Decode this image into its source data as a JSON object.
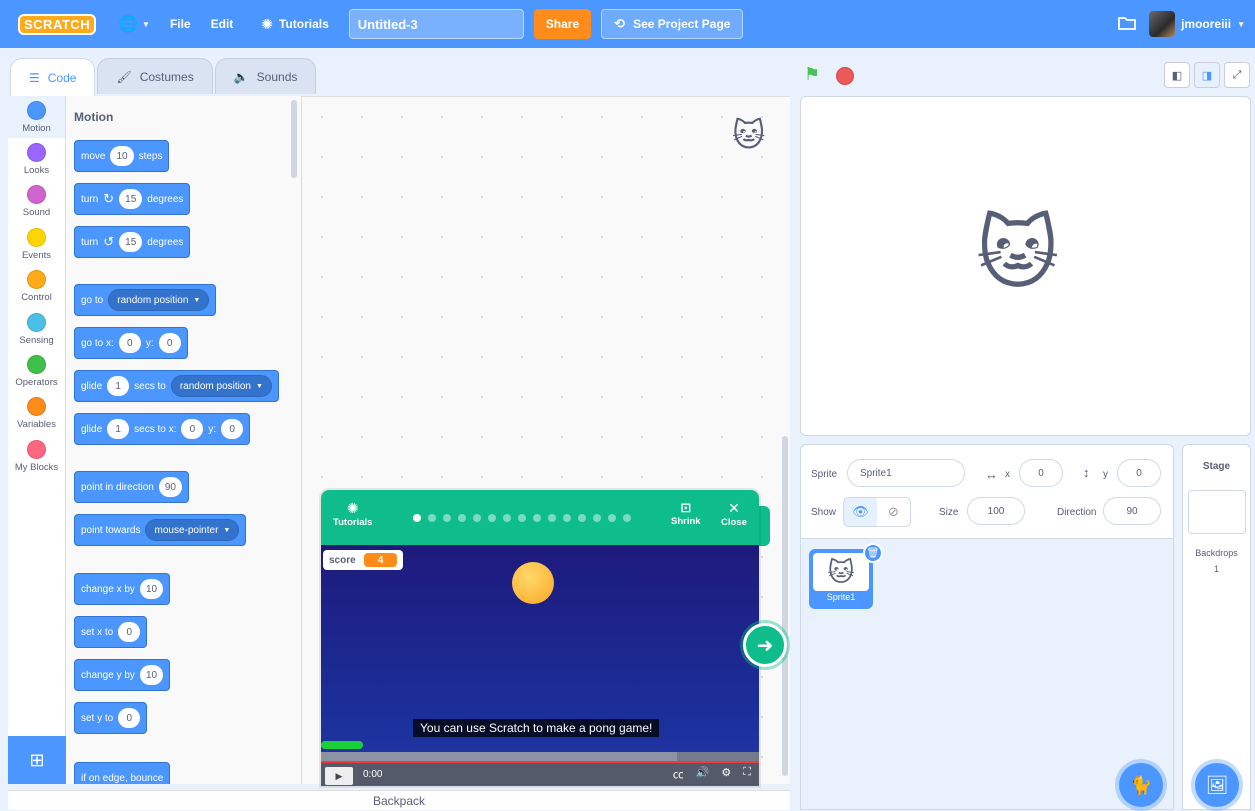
{
  "menubar": {
    "logo": "SCRATCH",
    "file": "File",
    "edit": "Edit",
    "tutorials": "Tutorials",
    "project_title": "Untitled-3",
    "share": "Share",
    "see_project": "See Project Page",
    "username": "jmooreiii"
  },
  "tabs": {
    "code": "Code",
    "costumes": "Costumes",
    "sounds": "Sounds"
  },
  "categories": [
    {
      "label": "Motion",
      "color": "#4c97ff"
    },
    {
      "label": "Looks",
      "color": "#9966ff"
    },
    {
      "label": "Sound",
      "color": "#cf63cf"
    },
    {
      "label": "Events",
      "color": "#ffd500"
    },
    {
      "label": "Control",
      "color": "#ffab19"
    },
    {
      "label": "Sensing",
      "color": "#4cbfe6"
    },
    {
      "label": "Operators",
      "color": "#40bf4a"
    },
    {
      "label": "Variables",
      "color": "#ff8c1a"
    },
    {
      "label": "My Blocks",
      "color": "#ff6680"
    }
  ],
  "palette": {
    "title": "Motion",
    "move": {
      "pre": "move",
      "val": "10",
      "post": "steps"
    },
    "turn_right": {
      "pre": "turn",
      "icon": "↻",
      "val": "15",
      "post": "degrees"
    },
    "turn_left": {
      "pre": "turn",
      "icon": "↺",
      "val": "15",
      "post": "degrees"
    },
    "goto": {
      "pre": "go to",
      "drop": "random position"
    },
    "goto_xy": {
      "pre": "go to x:",
      "x": "0",
      "ylabel": "y:",
      "y": "0"
    },
    "glide_to": {
      "pre": "glide",
      "secs": "1",
      "mid": "secs to",
      "drop": "random position"
    },
    "glide_xy": {
      "pre": "glide",
      "secs": "1",
      "mid": "secs to x:",
      "x": "0",
      "ylabel": "y:",
      "y": "0"
    },
    "point_dir": {
      "pre": "point in direction",
      "val": "90"
    },
    "point_towards": {
      "pre": "point towards",
      "drop": "mouse-pointer"
    },
    "change_x": {
      "pre": "change x by",
      "val": "10"
    },
    "set_x": {
      "pre": "set x to",
      "val": "0"
    },
    "change_y": {
      "pre": "change y by",
      "val": "10"
    },
    "set_y": {
      "pre": "set y to",
      "val": "0"
    },
    "bounce": "if on edge, bounce"
  },
  "backpack": "Backpack",
  "sprite_info": {
    "sprite_label": "Sprite",
    "sprite_name": "Sprite1",
    "x_label": "x",
    "x": "0",
    "y_label": "y",
    "y": "0",
    "show_label": "Show",
    "size_label": "Size",
    "size": "100",
    "direction_label": "Direction",
    "direction": "90"
  },
  "sprites": [
    {
      "name": "Sprite1"
    }
  ],
  "stage_pane": {
    "title": "Stage",
    "backdrops_label": "Backdrops",
    "backdrops_count": "1"
  },
  "tutorial": {
    "label": "Tutorials",
    "shrink": "Shrink",
    "close": "Close",
    "score_label": "score",
    "score": "4",
    "caption": "You can use Scratch to make a pong game!",
    "time": "0:00",
    "step_index": 0,
    "step_count": 15
  }
}
